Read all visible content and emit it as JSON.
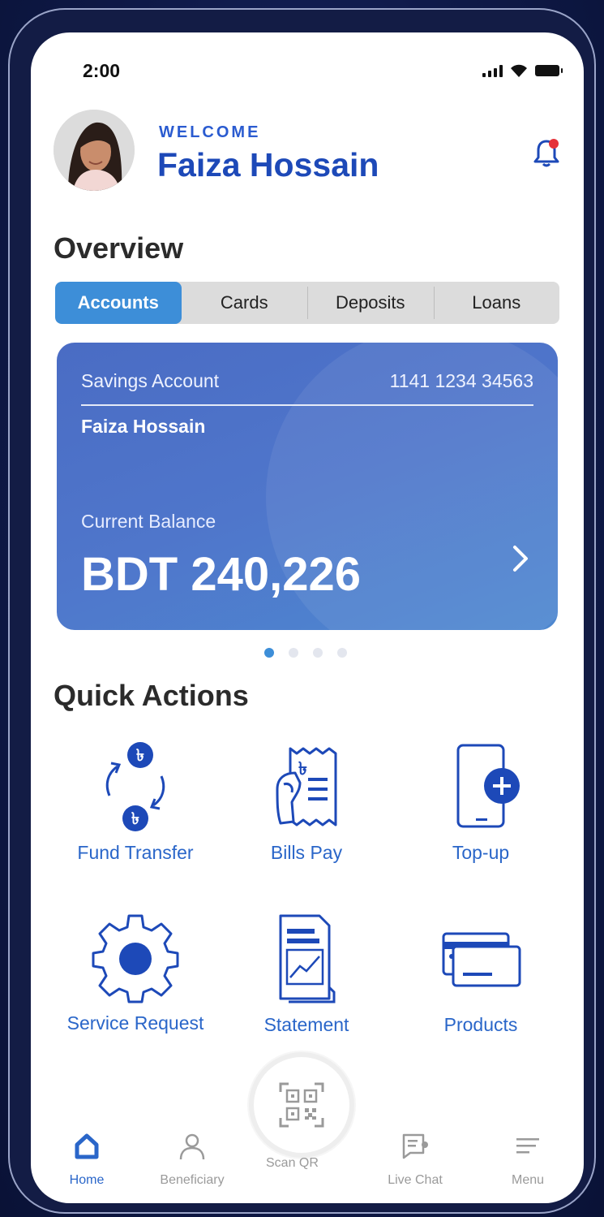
{
  "status_bar": {
    "time": "2:00"
  },
  "header": {
    "welcome": "WELCOME",
    "user_name": "Faiza Hossain"
  },
  "overview": {
    "title": "Overview",
    "tabs": [
      {
        "label": "Accounts",
        "active": true
      },
      {
        "label": "Cards",
        "active": false
      },
      {
        "label": "Deposits",
        "active": false
      },
      {
        "label": "Loans",
        "active": false
      }
    ]
  },
  "account_card": {
    "type": "Savings Account",
    "number": "1141 1234 34563",
    "holder": "Faiza Hossain",
    "balance_label": "Current Balance",
    "balance": "BDT 240,226"
  },
  "carousel": {
    "count": 4,
    "active_index": 0
  },
  "quick_actions": {
    "title": "Quick Actions",
    "items": [
      {
        "label": "Fund Transfer",
        "icon": "fund-transfer-icon"
      },
      {
        "label": "Bills Pay",
        "icon": "bills-pay-icon"
      },
      {
        "label": "Top-up",
        "icon": "top-up-icon"
      },
      {
        "label": "Service Request",
        "icon": "gear-icon"
      },
      {
        "label": "Statement",
        "icon": "statement-icon"
      },
      {
        "label": "Products",
        "icon": "cards-icon"
      }
    ]
  },
  "scan_qr": {
    "label": "Scan QR"
  },
  "bottom_nav": {
    "items": [
      {
        "label": "Home",
        "active": true
      },
      {
        "label": "Beneficiary",
        "active": false
      },
      {
        "label": "Live Chat",
        "active": false
      },
      {
        "label": "Menu",
        "active": false
      }
    ]
  },
  "colors": {
    "primary": "#1d49b8",
    "accent": "#3d8ed8",
    "card": "#4f76cb",
    "notification_dot": "#e5323a"
  }
}
